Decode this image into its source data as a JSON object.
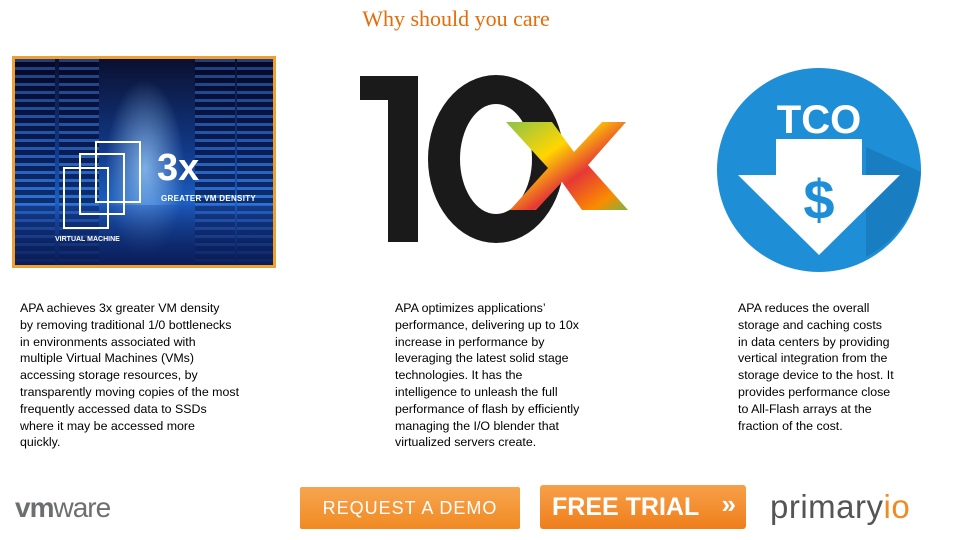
{
  "title": "Why should you care",
  "graphic_left": {
    "big": "3x",
    "sub": "GREATER VM DENSITY",
    "caption": "VIRTUAL MACHINE"
  },
  "graphic_middle": {
    "text_main": "10",
    "text_x": "x"
  },
  "graphic_right": {
    "label": "TCO",
    "symbol": "$"
  },
  "descriptions": [
    {
      "lines": [
        "APA achieves 3x greater VM  density",
        "by  removing traditional 1/0 bottlenecks",
        "in environments associated with",
        "multiple Virtual Machines (VMs)",
        "accessing storage resources, by",
        "transparently moving copies of the most",
        "frequently accessed data to SSDs",
        "where it may be accessed more",
        "quickly."
      ]
    },
    {
      "lines": [
        "APA optimizes applications’",
        "performance, delivering up to 10x",
        "increase in performance by",
        "leveraging the latest solid stage",
        "technologies. It has the",
        "intelligence to unleash the full",
        "performance of flash by efficiently",
        "managing the I/O blender that",
        "virtualized servers create."
      ]
    },
    {
      "lines": [
        "APA reduces the overall",
        "storage and caching costs",
        "in data centers by providing",
        "vertical integration from the",
        "storage device to the host. It",
        "provides performance close",
        "to All-Flash arrays at the",
        "fraction of the cost."
      ]
    }
  ],
  "footer": {
    "vmware_vm": "vm",
    "vmware_ware": "ware",
    "demo_label": "REQUEST A DEMO",
    "trial_label": "FREE TRIAL",
    "trial_arrow": "»",
    "primary": "primary",
    "io": "io"
  },
  "colors": {
    "accent": "#E46C0A",
    "button": "#F08A22",
    "tco_blue": "#1E8FD6"
  }
}
